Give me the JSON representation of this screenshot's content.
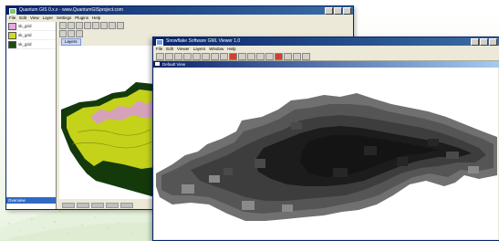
{
  "back_window": {
    "title": "Quantum GIS 0.x.x - www.QuantumGISproject.com",
    "menus": [
      "File",
      "Edit",
      "View",
      "Layer",
      "Settings",
      "Plugins",
      "Help"
    ],
    "layers": [
      {
        "label": "sk_grid",
        "color": "#e8a8e0"
      },
      {
        "label": "sk_grid",
        "color": "#d4dc1c"
      },
      {
        "label": "sk_grid",
        "color": "#1c4c10"
      }
    ],
    "overview_label": "Overview",
    "tab_label": "Layers",
    "map_colors": {
      "outer": "#143a0c",
      "fill": "#c4d21a",
      "highlight": "#d89ad6"
    }
  },
  "front_window": {
    "title": "Snowflake Software GML Viewer 1.0",
    "menus": [
      "File",
      "Edit",
      "Viewer",
      "Layers",
      "Window",
      "Help"
    ],
    "document_title": "Default View",
    "raster_colors": [
      "#141414",
      "#262626",
      "#3d3d3d",
      "#555555",
      "#707070"
    ]
  }
}
